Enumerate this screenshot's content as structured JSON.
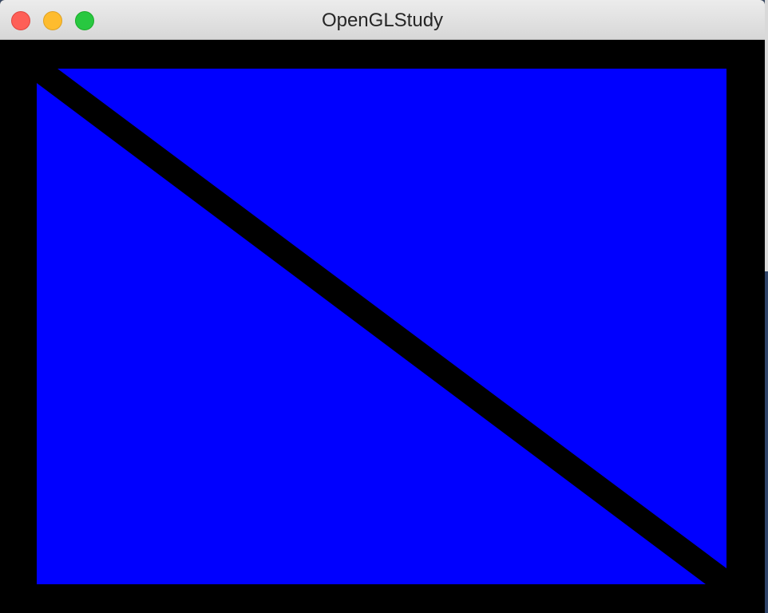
{
  "window": {
    "title": "OpenGLStudy",
    "traffic_lights": {
      "close_color": "#fe5f57",
      "minimize_color": "#febc2e",
      "zoom_color": "#28c840"
    }
  },
  "canvas": {
    "clear_color": "#000000",
    "fill_color": "#0000ff",
    "line_color": "#000000"
  }
}
